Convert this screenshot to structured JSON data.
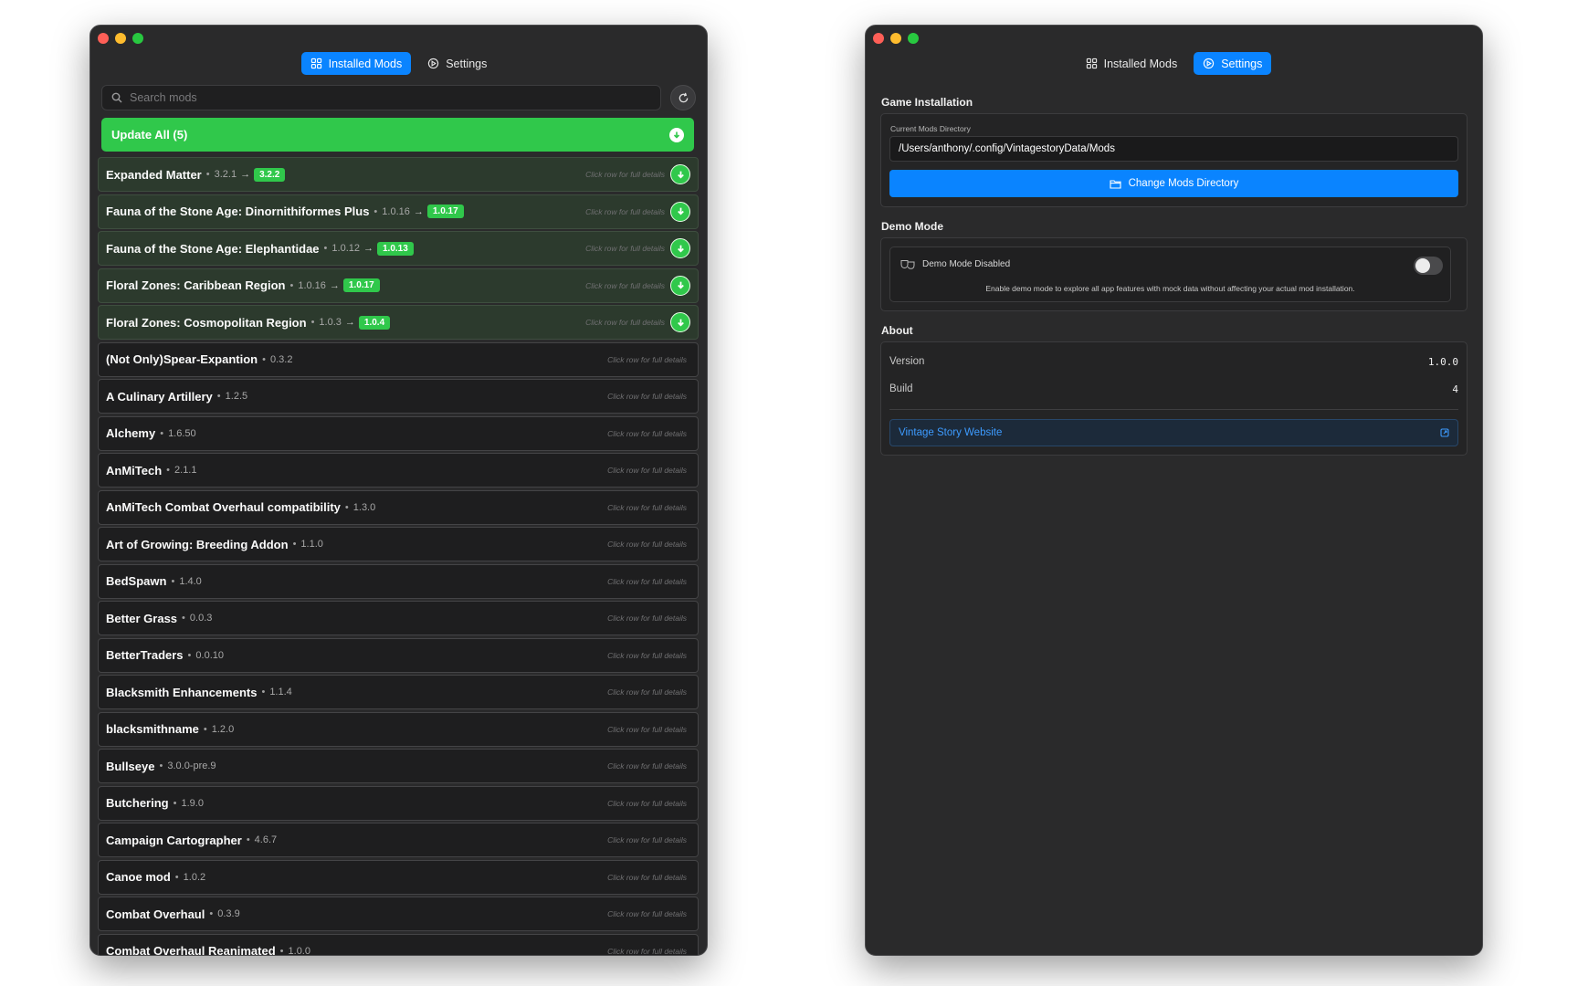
{
  "left_window": {
    "tabs": [
      {
        "label": "Installed Mods",
        "active": true,
        "icon": "grid-icon"
      },
      {
        "label": "Settings",
        "active": false,
        "icon": "gear-icon"
      }
    ],
    "search": {
      "placeholder": "Search mods",
      "value": ""
    },
    "update_all_label": "Update All (5)",
    "updatable_mods": [
      {
        "name": "Expanded Matter",
        "version": "3.2.1",
        "new_version": "3.2.2",
        "hint": "Click row for full details"
      },
      {
        "name": "Fauna of the Stone Age: Dinornithiformes Plus",
        "version": "1.0.16",
        "new_version": "1.0.17",
        "hint": "Click row for full details"
      },
      {
        "name": "Fauna of the Stone Age: Elephantidae",
        "version": "1.0.12",
        "new_version": "1.0.13",
        "hint": "Click row for full details"
      },
      {
        "name": "Floral Zones: Caribbean Region",
        "version": "1.0.16",
        "new_version": "1.0.17",
        "hint": "Click row for full details"
      },
      {
        "name": "Floral Zones: Cosmopolitan Region",
        "version": "1.0.3",
        "new_version": "1.0.4",
        "hint": "Click row for full details"
      }
    ],
    "mods": [
      {
        "name": "(Not Only)Spear-Expantion",
        "version": "0.3.2",
        "hint": "Click row for full details"
      },
      {
        "name": "A Culinary Artillery",
        "version": "1.2.5",
        "hint": "Click row for full details"
      },
      {
        "name": "Alchemy",
        "version": "1.6.50",
        "hint": "Click row for full details"
      },
      {
        "name": "AnMiTech",
        "version": "2.1.1",
        "hint": "Click row for full details"
      },
      {
        "name": "AnMiTech Combat Overhaul compatibility",
        "version": "1.3.0",
        "hint": "Click row for full details"
      },
      {
        "name": "Art of Growing: Breeding Addon",
        "version": "1.1.0",
        "hint": "Click row for full details"
      },
      {
        "name": "BedSpawn",
        "version": "1.4.0",
        "hint": "Click row for full details"
      },
      {
        "name": "Better Grass",
        "version": "0.0.3",
        "hint": "Click row for full details"
      },
      {
        "name": "BetterTraders",
        "version": "0.0.10",
        "hint": "Click row for full details"
      },
      {
        "name": "Blacksmith Enhancements",
        "version": "1.1.4",
        "hint": "Click row for full details"
      },
      {
        "name": "blacksmithname",
        "version": "1.2.0",
        "hint": "Click row for full details"
      },
      {
        "name": "Bullseye",
        "version": "3.0.0-pre.9",
        "hint": "Click row for full details"
      },
      {
        "name": "Butchering",
        "version": "1.9.0",
        "hint": "Click row for full details"
      },
      {
        "name": "Campaign Cartographer",
        "version": "4.6.7",
        "hint": "Click row for full details"
      },
      {
        "name": "Canoe mod",
        "version": "1.0.2",
        "hint": "Click row for full details"
      },
      {
        "name": "Combat Overhaul",
        "version": "0.3.9",
        "hint": "Click row for full details"
      },
      {
        "name": "Combat Overhaul Reanimated",
        "version": "1.0.0",
        "hint": "Click row for full details"
      }
    ]
  },
  "right_window": {
    "tabs": [
      {
        "label": "Installed Mods",
        "active": false,
        "icon": "grid-icon"
      },
      {
        "label": "Settings",
        "active": true,
        "icon": "gear-icon"
      }
    ],
    "game_installation": {
      "title": "Game Installation",
      "dir_label": "Current Mods Directory",
      "dir_value": "/Users/anthony/.config/VintagestoryData/Mods",
      "change_button": "Change Mods Directory"
    },
    "demo_mode": {
      "title": "Demo Mode",
      "status": "Demo Mode Disabled",
      "enabled": false,
      "description": "Enable demo mode to explore all app features with mock data without affecting your actual mod installation."
    },
    "about": {
      "title": "About",
      "version_label": "Version",
      "version_value": "1.0.0",
      "build_label": "Build",
      "build_value": "4",
      "website_label": "Vintage Story Website"
    }
  },
  "colors": {
    "accent": "#0a84ff",
    "success": "#30c84b",
    "window_bg": "#2a2a2b"
  }
}
